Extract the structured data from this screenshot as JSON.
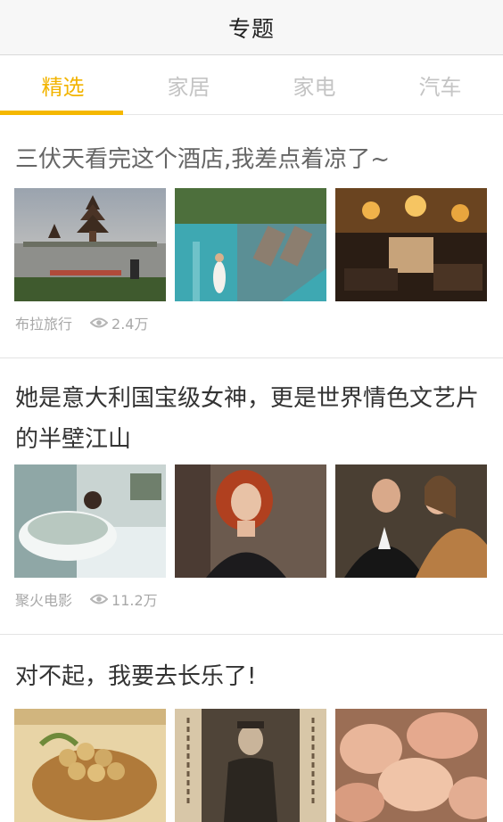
{
  "navbar": {
    "title": "专题"
  },
  "tabs": [
    {
      "label": "精选",
      "active": true
    },
    {
      "label": "家居",
      "active": false
    },
    {
      "label": "家电",
      "active": false
    },
    {
      "label": "汽车",
      "active": false
    }
  ],
  "articles": [
    {
      "title": "三伏天看完这个酒店,我差点着凉了~",
      "source": "布拉旅行",
      "views": "2.4万",
      "images": [
        "bali-temple-lake-photo",
        "resort-pool-woman-photo",
        "hotel-lobby-interior-photo"
      ]
    },
    {
      "title": "她是意大利国宝级女神，更是世界情色文艺片的半壁江山",
      "source": "聚火电影",
      "views": "11.2万",
      "images": [
        "woman-in-bathtub-photo",
        "red-haired-actress-photo",
        "couple-in-fur-coat-photo"
      ]
    },
    {
      "title": "对不起，我要去长乐了!",
      "images": [
        "longan-basket-photo",
        "historical-officer-portrait-photo",
        "clams-closeup-photo"
      ]
    }
  ],
  "colors": {
    "accent": "#f5b800",
    "tab_inactive": "#c4c4c4",
    "meta": "#a8a8a8"
  },
  "icons": {
    "views": "eye-icon"
  }
}
